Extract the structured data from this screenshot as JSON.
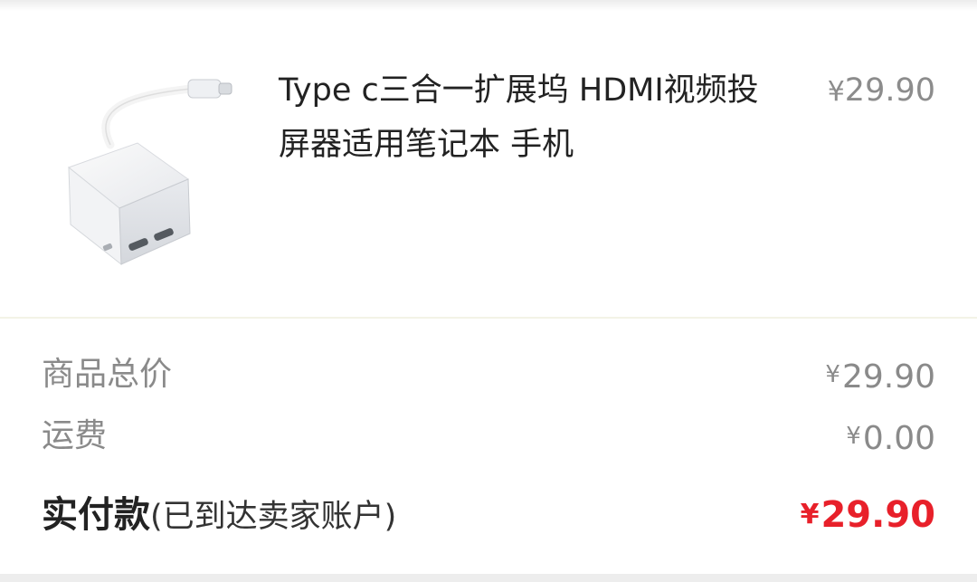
{
  "product": {
    "title": "Type c三合一扩展坞 HDMI视频投屏器适用笔记本 手机",
    "price_currency": "¥",
    "price_amount": "29.90",
    "image_icon": "usb-c-hub-image"
  },
  "summary": {
    "subtotal_label": "商品总价",
    "subtotal_currency": "¥",
    "subtotal_amount": "29.90",
    "shipping_label": "运费",
    "shipping_currency": "¥",
    "shipping_amount": "0.00",
    "paid_label": "实付款",
    "paid_note": "(已到达卖家账户)",
    "paid_currency": "¥",
    "paid_amount": "29.90"
  },
  "colors": {
    "accent_price": "#e8202a",
    "muted_text": "#8a8a8a",
    "primary_text": "#222222"
  }
}
